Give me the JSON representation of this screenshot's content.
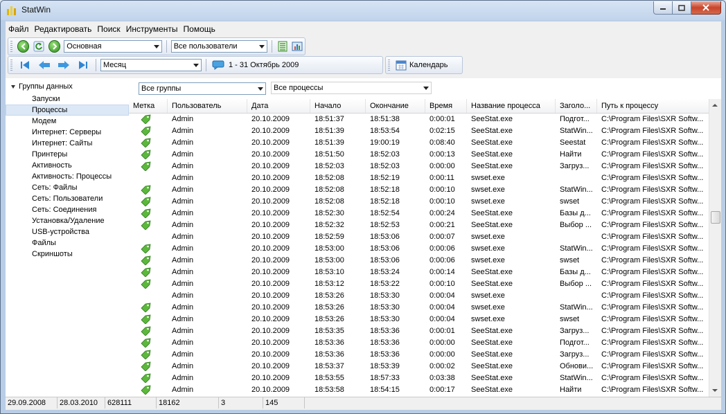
{
  "window": {
    "title": "StatWin"
  },
  "menu": [
    "Файл",
    "Редактировать",
    "Поиск",
    "Инструменты",
    "Помощь"
  ],
  "toolbar1": {
    "profile": "Основная",
    "users": "Все пользователи"
  },
  "toolbar2": {
    "period": "Месяц",
    "range": "1 - 31 Октябрь 2009",
    "calendar": "Календарь"
  },
  "tree": {
    "root": "Группы данных",
    "items": [
      "Запуски",
      "Процессы",
      "Модем",
      "Интернет: Серверы",
      "Интернет: Сайты",
      "Принтеры",
      "Активность",
      "Активность: Процессы",
      "Сеть: Файлы",
      "Сеть: Пользователи",
      "Сеть: Соединения",
      "Установка/Удаление",
      "USB-устройства",
      "Файлы",
      "Скриншоты"
    ],
    "selected_index": 1
  },
  "filters": {
    "groups": "Все группы",
    "processes": "Все процессы"
  },
  "columns": [
    "Метка",
    "Пользователь",
    "Дата",
    "Начало",
    "Окончание",
    "Время",
    "Название процесса",
    "Заголо...",
    "Путь к процессу"
  ],
  "rows": [
    {
      "tag": true,
      "user": "Admin",
      "date": "20.10.2009",
      "start": "18:51:37",
      "end": "18:51:38",
      "dur": "0:00:01",
      "proc": "SeeStat.exe",
      "title": "Подгот...",
      "path": "C:\\Program Files\\SXR Softw..."
    },
    {
      "tag": true,
      "user": "Admin",
      "date": "20.10.2009",
      "start": "18:51:39",
      "end": "18:53:54",
      "dur": "0:02:15",
      "proc": "SeeStat.exe",
      "title": "StatWin...",
      "path": "C:\\Program Files\\SXR Softw..."
    },
    {
      "tag": true,
      "user": "Admin",
      "date": "20.10.2009",
      "start": "18:51:39",
      "end": "19:00:19",
      "dur": "0:08:40",
      "proc": "SeeStat.exe",
      "title": "Seestat",
      "path": "C:\\Program Files\\SXR Softw..."
    },
    {
      "tag": true,
      "user": "Admin",
      "date": "20.10.2009",
      "start": "18:51:50",
      "end": "18:52:03",
      "dur": "0:00:13",
      "proc": "SeeStat.exe",
      "title": "Найти",
      "path": "C:\\Program Files\\SXR Softw..."
    },
    {
      "tag": true,
      "user": "Admin",
      "date": "20.10.2009",
      "start": "18:52:03",
      "end": "18:52:03",
      "dur": "0:00:00",
      "proc": "SeeStat.exe",
      "title": "Загруз...",
      "path": "C:\\Program Files\\SXR Softw..."
    },
    {
      "tag": false,
      "user": "Admin",
      "date": "20.10.2009",
      "start": "18:52:08",
      "end": "18:52:19",
      "dur": "0:00:11",
      "proc": "swset.exe",
      "title": "",
      "path": "C:\\Program Files\\SXR Softw..."
    },
    {
      "tag": true,
      "user": "Admin",
      "date": "20.10.2009",
      "start": "18:52:08",
      "end": "18:52:18",
      "dur": "0:00:10",
      "proc": "swset.exe",
      "title": "StatWin...",
      "path": "C:\\Program Files\\SXR Softw..."
    },
    {
      "tag": true,
      "user": "Admin",
      "date": "20.10.2009",
      "start": "18:52:08",
      "end": "18:52:18",
      "dur": "0:00:10",
      "proc": "swset.exe",
      "title": "swset",
      "path": "C:\\Program Files\\SXR Softw..."
    },
    {
      "tag": true,
      "user": "Admin",
      "date": "20.10.2009",
      "start": "18:52:30",
      "end": "18:52:54",
      "dur": "0:00:24",
      "proc": "SeeStat.exe",
      "title": "Базы д...",
      "path": "C:\\Program Files\\SXR Softw..."
    },
    {
      "tag": true,
      "user": "Admin",
      "date": "20.10.2009",
      "start": "18:52:32",
      "end": "18:52:53",
      "dur": "0:00:21",
      "proc": "SeeStat.exe",
      "title": "Выбор ...",
      "path": "C:\\Program Files\\SXR Softw..."
    },
    {
      "tag": false,
      "user": "Admin",
      "date": "20.10.2009",
      "start": "18:52:59",
      "end": "18:53:06",
      "dur": "0:00:07",
      "proc": "swset.exe",
      "title": "",
      "path": "C:\\Program Files\\SXR Softw..."
    },
    {
      "tag": true,
      "user": "Admin",
      "date": "20.10.2009",
      "start": "18:53:00",
      "end": "18:53:06",
      "dur": "0:00:06",
      "proc": "swset.exe",
      "title": "StatWin...",
      "path": "C:\\Program Files\\SXR Softw..."
    },
    {
      "tag": true,
      "user": "Admin",
      "date": "20.10.2009",
      "start": "18:53:00",
      "end": "18:53:06",
      "dur": "0:00:06",
      "proc": "swset.exe",
      "title": "swset",
      "path": "C:\\Program Files\\SXR Softw..."
    },
    {
      "tag": true,
      "user": "Admin",
      "date": "20.10.2009",
      "start": "18:53:10",
      "end": "18:53:24",
      "dur": "0:00:14",
      "proc": "SeeStat.exe",
      "title": "Базы д...",
      "path": "C:\\Program Files\\SXR Softw..."
    },
    {
      "tag": true,
      "user": "Admin",
      "date": "20.10.2009",
      "start": "18:53:12",
      "end": "18:53:22",
      "dur": "0:00:10",
      "proc": "SeeStat.exe",
      "title": "Выбор ...",
      "path": "C:\\Program Files\\SXR Softw..."
    },
    {
      "tag": false,
      "user": "Admin",
      "date": "20.10.2009",
      "start": "18:53:26",
      "end": "18:53:30",
      "dur": "0:00:04",
      "proc": "swset.exe",
      "title": "",
      "path": "C:\\Program Files\\SXR Softw..."
    },
    {
      "tag": true,
      "user": "Admin",
      "date": "20.10.2009",
      "start": "18:53:26",
      "end": "18:53:30",
      "dur": "0:00:04",
      "proc": "swset.exe",
      "title": "StatWin...",
      "path": "C:\\Program Files\\SXR Softw..."
    },
    {
      "tag": true,
      "user": "Admin",
      "date": "20.10.2009",
      "start": "18:53:26",
      "end": "18:53:30",
      "dur": "0:00:04",
      "proc": "swset.exe",
      "title": "swset",
      "path": "C:\\Program Files\\SXR Softw..."
    },
    {
      "tag": true,
      "user": "Admin",
      "date": "20.10.2009",
      "start": "18:53:35",
      "end": "18:53:36",
      "dur": "0:00:01",
      "proc": "SeeStat.exe",
      "title": "Загруз...",
      "path": "C:\\Program Files\\SXR Softw..."
    },
    {
      "tag": true,
      "user": "Admin",
      "date": "20.10.2009",
      "start": "18:53:36",
      "end": "18:53:36",
      "dur": "0:00:00",
      "proc": "SeeStat.exe",
      "title": "Подгот...",
      "path": "C:\\Program Files\\SXR Softw..."
    },
    {
      "tag": true,
      "user": "Admin",
      "date": "20.10.2009",
      "start": "18:53:36",
      "end": "18:53:36",
      "dur": "0:00:00",
      "proc": "SeeStat.exe",
      "title": "Загруз...",
      "path": "C:\\Program Files\\SXR Softw..."
    },
    {
      "tag": true,
      "user": "Admin",
      "date": "20.10.2009",
      "start": "18:53:37",
      "end": "18:53:39",
      "dur": "0:00:02",
      "proc": "SeeStat.exe",
      "title": "Обнови...",
      "path": "C:\\Program Files\\SXR Softw..."
    },
    {
      "tag": true,
      "user": "Admin",
      "date": "20.10.2009",
      "start": "18:53:55",
      "end": "18:57:33",
      "dur": "0:03:38",
      "proc": "SeeStat.exe",
      "title": "StatWin...",
      "path": "C:\\Program Files\\SXR Softw..."
    },
    {
      "tag": true,
      "user": "Admin",
      "date": "20.10.2009",
      "start": "18:53:58",
      "end": "18:54:15",
      "dur": "0:00:17",
      "proc": "SeeStat.exe",
      "title": "Найти",
      "path": "C:\\Program Files\\SXR Softw..."
    }
  ],
  "status": [
    "29.09.2008",
    "28.03.2010",
    "628111",
    "18162",
    "3",
    "145"
  ],
  "colors": {
    "accent": "#3b9ed8",
    "tag_green": "#5cb83c",
    "selection": "#dce8f6"
  }
}
